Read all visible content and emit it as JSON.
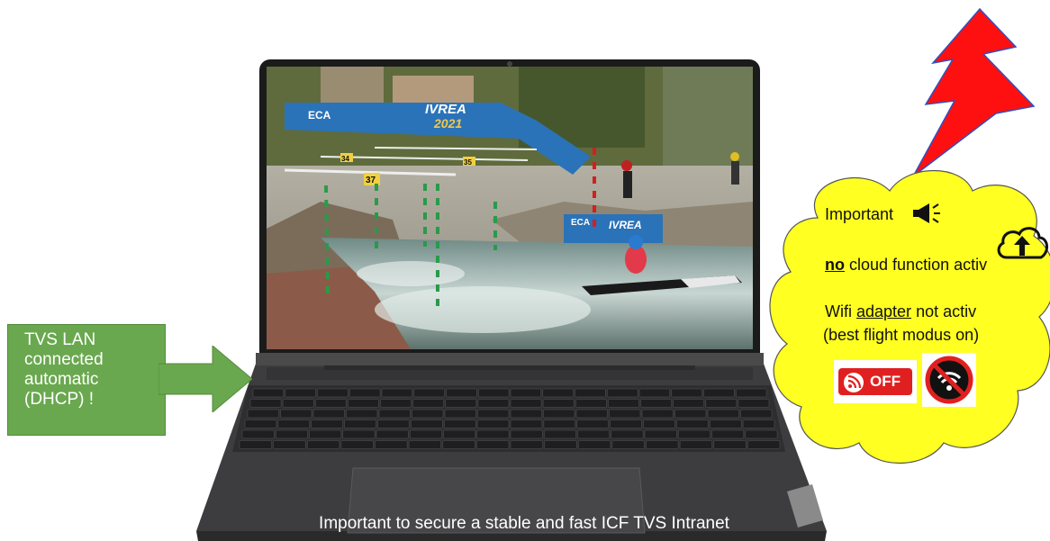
{
  "left_note": {
    "lines": [
      "TVS LAN",
      "connected",
      "automatic",
      "(DHCP) !"
    ],
    "color": "#6aa84f"
  },
  "cloud_note": {
    "important_label": "Important",
    "no_label": "no",
    "cloud_rest": "cloud function activ",
    "wifi_prefix": "Wifi ",
    "wifi_adapter": "adapter",
    "wifi_suffix": " not activ",
    "flight_mode": "(best flight modus on)",
    "off_label": "OFF",
    "icons": [
      "megaphone-icon",
      "cloud-upload-icon",
      "rss-off-icon",
      "no-wifi-icon"
    ],
    "color": "#ffff22"
  },
  "screen": {
    "banner_logo": "ECA",
    "banner_title": "IVREA",
    "banner_year": "2021",
    "gate_numbers": [
      "37",
      "34",
      "35"
    ]
  },
  "caption": "Important to secure a stable and fast ICF TVS Intranet",
  "bolt_color": "#ff1010"
}
